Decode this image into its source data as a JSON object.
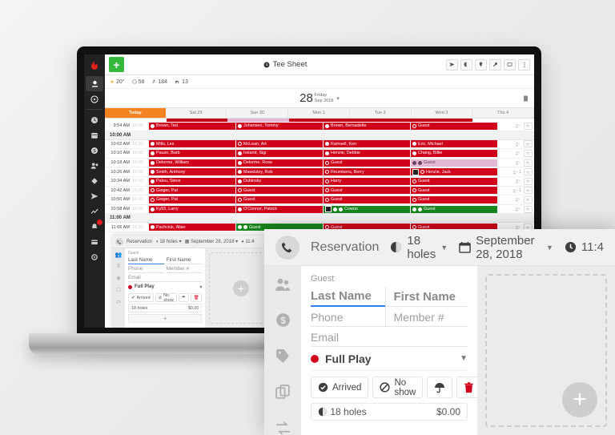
{
  "app": {
    "title": "Tee Sheet",
    "add_label": "+",
    "toolbar_icons": [
      "send-icon",
      "contrast-icon",
      "pin-icon",
      "wrench-icon",
      "monitor-icon",
      "more-icon"
    ],
    "stats": [
      {
        "icon": "sun-icon",
        "value": "20°"
      },
      {
        "icon": "ball-icon",
        "value": "58"
      },
      {
        "icon": "golfer-icon",
        "value": "184"
      },
      {
        "icon": "cart-icon",
        "value": "13"
      }
    ],
    "date": {
      "day": "28",
      "weekday": "Friday",
      "monthyear": "Sep 2018"
    },
    "day_tabs": [
      "Today",
      "Sat 29",
      "Sun 30",
      "Mon 1",
      "Tue 2",
      "Wed 3",
      "Thu 4"
    ],
    "sidebar": [
      {
        "name": "logo-flame",
        "icon": "flame-icon"
      },
      {
        "name": "tee-sheet",
        "icon": "tee-sheet-icon",
        "active": true
      },
      {
        "name": "dashboard",
        "icon": "dashboard-icon"
      },
      {
        "name": "clock",
        "icon": "clock-icon"
      },
      {
        "name": "calendar",
        "icon": "calendar-icon"
      },
      {
        "name": "dollar",
        "icon": "dollar-icon"
      },
      {
        "name": "people",
        "icon": "people-icon"
      },
      {
        "name": "tag",
        "icon": "tag-icon"
      },
      {
        "name": "send",
        "icon": "send-icon"
      },
      {
        "name": "reports",
        "icon": "chart-icon"
      },
      {
        "name": "alerts",
        "icon": "bell-icon",
        "badge": true
      },
      {
        "name": "card",
        "icon": "card-icon"
      },
      {
        "name": "settings",
        "icon": "gear-icon"
      }
    ]
  },
  "sheet": {
    "rows": [
      {
        "type": "slot",
        "time": "9:54 AM",
        "rate": "10.00",
        "slots": [
          {
            "color": "red",
            "dots": [
              "filled"
            ],
            "label": "Brown, Ted"
          },
          {
            "color": "red",
            "dots": [
              "filled"
            ],
            "label": "Johansen, Tommy"
          },
          {
            "color": "red",
            "dots": [
              "filled"
            ],
            "label": "Brown, Bernadette"
          },
          {
            "color": "red",
            "dots": [
              "open"
            ],
            "label": "Guest"
          }
        ],
        "players": "",
        "cart": true
      },
      {
        "type": "hour",
        "label": "10:00 AM"
      },
      {
        "type": "slot",
        "time": "10:02 AM",
        "rate": "10.00",
        "slots": [
          {
            "color": "red",
            "dots": [
              "filled"
            ],
            "label": "Mills, Les"
          },
          {
            "color": "red",
            "dots": [
              "open"
            ],
            "label": "McLean, Art"
          },
          {
            "color": "red",
            "dots": [
              "filled"
            ],
            "label": "Ramsell, Ken"
          },
          {
            "color": "red",
            "dots": [
              "filled"
            ],
            "label": "Eric, Michael"
          }
        ],
        "players": "",
        "cart": true
      },
      {
        "type": "slot",
        "time": "10:10 AM",
        "rate": "10.00",
        "slots": [
          {
            "color": "red",
            "dots": [
              "filled"
            ],
            "label": "Pauze, Barb"
          },
          {
            "color": "red",
            "dots": [
              "filled"
            ],
            "label": "Ireland, Sigi"
          },
          {
            "color": "red",
            "dots": [
              "filled"
            ],
            "label": "Henzie, Debbie"
          },
          {
            "color": "red",
            "dots": [
              "filled"
            ],
            "label": "Chang, Billie"
          }
        ],
        "players": "",
        "cart": true
      },
      {
        "type": "slot",
        "time": "10:18 AM",
        "rate": "10.00",
        "slots": [
          {
            "color": "red",
            "dots": [
              "filled"
            ],
            "label": "Delorme, William"
          },
          {
            "color": "red",
            "dots": [
              "filled"
            ],
            "label": "Delorme, Rose"
          },
          {
            "color": "red",
            "dots": [
              "open"
            ],
            "label": "Guest"
          },
          {
            "color": "pink",
            "dots": [
              "filled",
              "filled"
            ],
            "label": "Guest"
          }
        ],
        "players": "",
        "cart": true
      },
      {
        "type": "slot",
        "time": "10:26 AM",
        "rate": "10.00",
        "slots": [
          {
            "color": "red",
            "dots": [
              "filled"
            ],
            "label": "Smith, Anthony"
          },
          {
            "color": "red",
            "dots": [
              "filled"
            ],
            "label": "Mawdsley, Rob"
          },
          {
            "color": "red",
            "dots": [
              "open"
            ],
            "label": "Reumkens, Berry"
          },
          {
            "color": "red",
            "dots": [
              "open"
            ],
            "label": "Henzie, Jack",
            "marker": true
          }
        ],
        "players": "1",
        "cart": true
      },
      {
        "type": "slot",
        "time": "10:34 AM",
        "rate": "10.00",
        "slots": [
          {
            "color": "red",
            "dots": [
              "filled"
            ],
            "label": "Palou, Steve"
          },
          {
            "color": "red",
            "dots": [
              "filled"
            ],
            "label": "Dubinsky"
          },
          {
            "color": "red",
            "dots": [
              "open"
            ],
            "label": "Harry"
          },
          {
            "color": "red",
            "dots": [
              "open"
            ],
            "label": "Guest"
          }
        ],
        "players": "",
        "cart": true
      },
      {
        "type": "slot",
        "time": "10:42 AM",
        "rate": "10.00",
        "slots": [
          {
            "color": "red",
            "dots": [
              "open"
            ],
            "label": "Geiger, Pat"
          },
          {
            "color": "red",
            "dots": [
              "open"
            ],
            "label": "Guest"
          },
          {
            "color": "red",
            "dots": [
              "open"
            ],
            "label": "Guest"
          },
          {
            "color": "red",
            "dots": [
              "open"
            ],
            "label": "Guest"
          }
        ],
        "players": "1",
        "cart": true
      },
      {
        "type": "slot",
        "time": "10:50 AM",
        "rate": "10.00",
        "slots": [
          {
            "color": "red",
            "dots": [
              "open"
            ],
            "label": "Geiger, Pat"
          },
          {
            "color": "red",
            "dots": [
              "open"
            ],
            "label": "Guest"
          },
          {
            "color": "red",
            "dots": [
              "open"
            ],
            "label": "Guest"
          },
          {
            "color": "red",
            "dots": [
              "open"
            ],
            "label": "Guest"
          }
        ],
        "players": "",
        "cart": true
      },
      {
        "type": "slot",
        "time": "10:58 AM",
        "rate": "10.00",
        "slots": [
          {
            "color": "red",
            "dots": [
              "filled"
            ],
            "label": "Ky55, Larry"
          },
          {
            "color": "red",
            "dots": [
              "filled"
            ],
            "label": "O'Connor, Patrick"
          },
          {
            "color": "green",
            "dots": [
              "filled",
              "filled"
            ],
            "label": "Cowon",
            "marker": true
          },
          {
            "color": "green",
            "dots": [
              "filled",
              "filled"
            ],
            "label": "Guest"
          }
        ],
        "players": "",
        "cart": true
      },
      {
        "type": "hour",
        "label": "11:00 AM"
      },
      {
        "type": "slot",
        "time": "11:06 AM",
        "rate": "10.00",
        "slots": [
          {
            "color": "red",
            "dots": [
              "filled"
            ],
            "label": "Pachciuk, Allan"
          },
          {
            "color": "green",
            "dots": [
              "filled",
              "filled"
            ],
            "label": "Guest"
          },
          {
            "color": "red",
            "dots": [
              "open"
            ],
            "label": "Guest"
          },
          {
            "color": "red",
            "dots": [
              "open"
            ],
            "label": "Guest"
          }
        ],
        "players": "",
        "cart": true
      }
    ]
  },
  "reservation": {
    "header": {
      "type_label": "Reservation",
      "holes": "18 holes",
      "date": "September 28, 2018",
      "time": "11:4"
    },
    "form": {
      "guest_label": "Guest",
      "last_name_placeholder": "Last Name",
      "first_name_placeholder": "First Name",
      "phone_placeholder": "Phone",
      "member_placeholder": "Member #",
      "email_placeholder": "Email",
      "play_type": "Full Play"
    },
    "actions": [
      {
        "label": "Arrived",
        "icon": "check-circle-icon"
      },
      {
        "label": "No show",
        "icon": "no-entry-icon"
      },
      {
        "label": "",
        "icon": "umbrella-icon"
      },
      {
        "label": "",
        "icon": "trash-icon"
      }
    ],
    "line_item": {
      "label": "18 holes",
      "price": "$0.00"
    },
    "add_label": "+",
    "fab_label": "+"
  },
  "colors": {
    "red": "#d0021b",
    "green": "#19861f",
    "pink": "#e3b6d4",
    "orange": "#f58220",
    "blue": "#2f80ed",
    "sidebar": "#222222"
  }
}
